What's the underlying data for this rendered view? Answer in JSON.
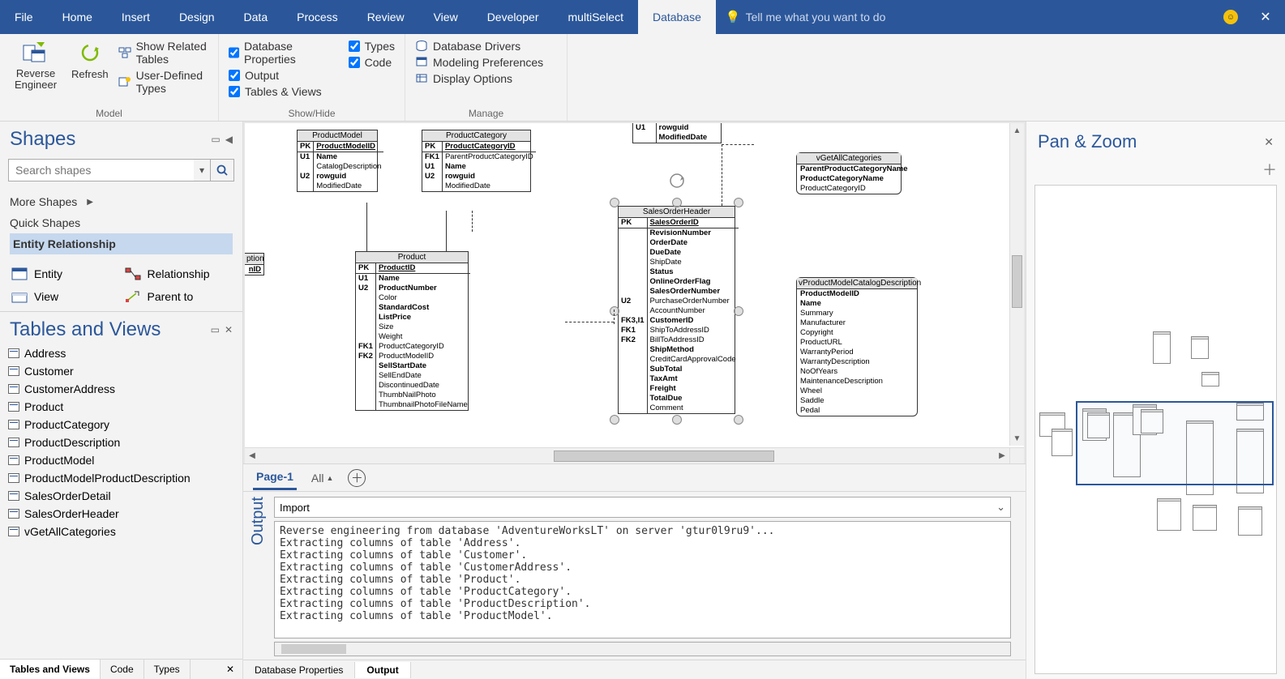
{
  "tabs": [
    "File",
    "Home",
    "Insert",
    "Design",
    "Data",
    "Process",
    "Review",
    "View",
    "Developer",
    "multiSelect",
    "Database"
  ],
  "active_tab": "Database",
  "tellme": "Tell me what you want to do",
  "ribbon": {
    "model": {
      "label": "Model",
      "reverse": "Reverse\nEngineer",
      "refresh": "Refresh",
      "related": "Show Related Tables",
      "udt": "User-Defined Types"
    },
    "showhide": {
      "label": "Show/Hide",
      "dbprops": "Database Properties",
      "output": "Output",
      "tv": "Tables & Views",
      "types": "Types",
      "code": "Code"
    },
    "manage": {
      "label": "Manage",
      "drivers": "Database Drivers",
      "modeling": "Modeling Preferences",
      "display": "Display Options"
    }
  },
  "shapes": {
    "title": "Shapes",
    "search_placeholder": "Search shapes",
    "more": "More Shapes",
    "quick": "Quick Shapes",
    "er": "Entity Relationship",
    "items": [
      {
        "label": "Entity"
      },
      {
        "label": "Relationship"
      },
      {
        "label": "View"
      },
      {
        "label": "Parent to"
      }
    ]
  },
  "tables_views": {
    "title": "Tables and Views",
    "items": [
      "Address",
      "Customer",
      "CustomerAddress",
      "Product",
      "ProductCategory",
      "ProductDescription",
      "ProductModel",
      "ProductModelProductDescription",
      "SalesOrderDetail",
      "SalesOrderHeader",
      "vGetAllCategories"
    ],
    "tabs": [
      "Tables and Views",
      "Code",
      "Types"
    ]
  },
  "pages": {
    "current": "Page-1",
    "all": "All"
  },
  "output": {
    "title": "Output",
    "mode": "Import",
    "log": "Reverse engineering from database 'AdventureWorksLT' on server 'gtur0l9ru9'...\nExtracting columns of table 'Address'.\nExtracting columns of table 'Customer'.\nExtracting columns of table 'CustomerAddress'.\nExtracting columns of table 'Product'.\nExtracting columns of table 'ProductCategory'.\nExtracting columns of table 'ProductDescription'.\nExtracting columns of table 'ProductModel'."
  },
  "bottom_tabs": [
    "Database Properties",
    "Output"
  ],
  "panzoom": {
    "title": "Pan & Zoom"
  },
  "entities": {
    "productmodel": {
      "name": "ProductModel",
      "pk": "ProductModelID",
      "rows": [
        [
          "U1",
          "Name",
          true
        ],
        [
          "",
          "CatalogDescription",
          false
        ],
        [
          "U2",
          "rowguid",
          true
        ],
        [
          "",
          "ModifiedDate",
          false
        ]
      ]
    },
    "productcategory": {
      "name": "ProductCategory",
      "pk": "ProductCategoryID",
      "rows": [
        [
          "FK1",
          "ParentProductCategoryID",
          false
        ],
        [
          "U1",
          "Name",
          true
        ],
        [
          "U2",
          "rowguid",
          true
        ],
        [
          "",
          "ModifiedDate",
          false
        ]
      ]
    },
    "toptrunc": {
      "rows": [
        [
          "U1",
          "rowguid",
          true
        ],
        [
          "",
          "ModifiedDate",
          true
        ]
      ]
    },
    "product": {
      "name": "Product",
      "pk": "ProductID",
      "rows": [
        [
          "U1",
          "Name",
          true
        ],
        [
          "U2",
          "ProductNumber",
          true
        ],
        [
          "",
          "Color",
          false
        ],
        [
          "",
          "StandardCost",
          true
        ],
        [
          "",
          "ListPrice",
          true
        ],
        [
          "",
          "Size",
          false
        ],
        [
          "",
          "Weight",
          false
        ],
        [
          "FK1",
          "ProductCategoryID",
          false
        ],
        [
          "FK2",
          "ProductModelID",
          false
        ],
        [
          "",
          "SellStartDate",
          true
        ],
        [
          "",
          "SellEndDate",
          false
        ],
        [
          "",
          "DiscontinuedDate",
          false
        ],
        [
          "",
          "ThumbNailPhoto",
          false
        ],
        [
          "",
          "ThumbnailPhotoFileName",
          false
        ]
      ]
    },
    "soh": {
      "name": "SalesOrderHeader",
      "pk": "SalesOrderID",
      "rows": [
        [
          "",
          "RevisionNumber",
          true
        ],
        [
          "",
          "OrderDate",
          true
        ],
        [
          "",
          "DueDate",
          true
        ],
        [
          "",
          "ShipDate",
          false
        ],
        [
          "",
          "Status",
          true
        ],
        [
          "",
          "OnlineOrderFlag",
          true
        ],
        [
          "",
          "SalesOrderNumber",
          true
        ],
        [
          "U2",
          "PurchaseOrderNumber",
          false
        ],
        [
          "",
          "AccountNumber",
          false
        ],
        [
          "FK3,I1",
          "CustomerID",
          true
        ],
        [
          "FK1",
          "ShipToAddressID",
          false
        ],
        [
          "FK2",
          "BillToAddressID",
          false
        ],
        [
          "",
          "ShipMethod",
          true
        ],
        [
          "",
          "CreditCardApprovalCode",
          false
        ],
        [
          "",
          "SubTotal",
          true
        ],
        [
          "",
          "TaxAmt",
          true
        ],
        [
          "",
          "Freight",
          true
        ],
        [
          "",
          "TotalDue",
          true
        ],
        [
          "",
          "Comment",
          false
        ]
      ]
    },
    "vgetall": {
      "name": "vGetAllCategories",
      "rows": [
        "ParentProductCategoryName",
        "ProductCategoryName",
        "ProductCategoryID"
      ]
    },
    "vprodcat": {
      "name": "vProductModelCatalogDescription",
      "rows": [
        "ProductModelID",
        "Name",
        "Summary",
        "Manufacturer",
        "Copyright",
        "ProductURL",
        "WarrantyPeriod",
        "WarrantyDescription",
        "NoOfYears",
        "MaintenanceDescription",
        "Wheel",
        "Saddle",
        "Pedal"
      ]
    },
    "lefttrunc": {
      "hdr": "ption",
      "pk": "ID"
    }
  }
}
